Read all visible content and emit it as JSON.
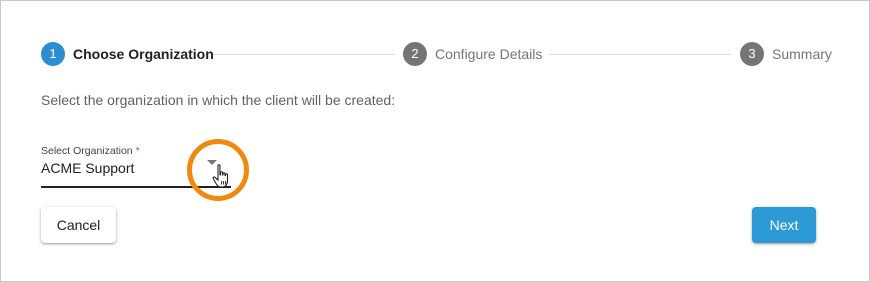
{
  "stepper": {
    "steps": [
      {
        "number": "1",
        "label": "Choose Organization",
        "state": "active"
      },
      {
        "number": "2",
        "label": "Configure Details",
        "state": "inactive"
      },
      {
        "number": "3",
        "label": "Summary",
        "state": "inactive"
      }
    ]
  },
  "instructions": "Select the organization in which the client will be created:",
  "organization_select": {
    "label": "Select Organization",
    "required_marker": "*",
    "value": "ACME Support"
  },
  "buttons": {
    "cancel_label": "Cancel",
    "next_label": "Next"
  },
  "icons": {
    "dropdown": "chevron-down-icon",
    "cursor": "hand-pointer-icon"
  },
  "colors": {
    "accent": "#2b8fcf",
    "next_button": "#2b9ad6",
    "highlight": "#f0890e",
    "inactive_step": "#757575"
  }
}
